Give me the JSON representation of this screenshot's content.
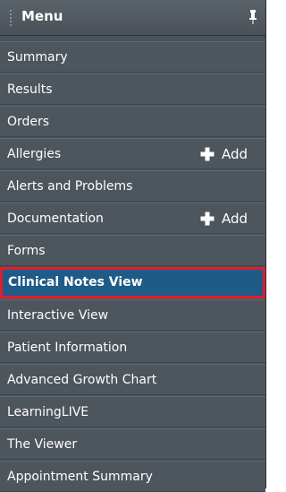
{
  "header": {
    "title": "Menu"
  },
  "items": [
    {
      "label": "Summary"
    },
    {
      "label": "Results"
    },
    {
      "label": "Orders"
    },
    {
      "label": "Allergies",
      "add_label": "Add"
    },
    {
      "label": "Alerts and Problems"
    },
    {
      "label": "Documentation",
      "add_label": "Add"
    },
    {
      "label": "Forms"
    },
    {
      "label": "Clinical Notes View",
      "selected": true
    },
    {
      "label": "Interactive View"
    },
    {
      "label": "Patient Information"
    },
    {
      "label": "Advanced Growth Chart"
    },
    {
      "label": "LearningLIVE"
    },
    {
      "label": "The Viewer"
    },
    {
      "label": "Appointment Summary"
    }
  ],
  "colors": {
    "panel_bg": "#49515a",
    "item_bg": "#4d555d",
    "selected_bg": "#1f5b86",
    "selected_border": "#e01d2d",
    "text": "#ffffff"
  },
  "icons": [
    "grip-icon",
    "pin-icon",
    "plus-icon"
  ]
}
